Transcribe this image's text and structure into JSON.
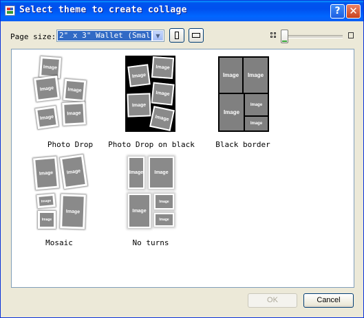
{
  "window": {
    "title": "Select theme to create collage",
    "help_label": "?",
    "close_label": "✕",
    "icons": {
      "app": "collage-app-icon",
      "help": "help-icon",
      "close": "close-icon"
    }
  },
  "toolbar": {
    "page_size_label": "Page size:",
    "page_size_value": "2\" x 3\" Wallet (Small)",
    "zoom_level": 0.0,
    "icons": {
      "portrait": "portrait-orientation-icon",
      "landscape": "landscape-orientation-icon",
      "zoom_small": "grid-thumbnails-icon",
      "zoom_large": "single-thumbnail-icon"
    }
  },
  "themes": [
    {
      "name": "Photo Drop",
      "image_labels": [
        "Image",
        "Image",
        "Image",
        "Image",
        "Image"
      ]
    },
    {
      "name": "Photo Drop on black",
      "image_labels": [
        "Image",
        "Image",
        "Image",
        "Image",
        "Image"
      ]
    },
    {
      "name": "Black border",
      "image_labels": [
        "Image",
        "Image",
        "Image",
        "Image",
        "Image"
      ]
    },
    {
      "name": "Mosaic",
      "image_labels": [
        "Image",
        "Image",
        "Image",
        "Image",
        "Image"
      ]
    },
    {
      "name": "No turns",
      "image_labels": [
        "Image",
        "Image",
        "Image",
        "Image",
        "Image"
      ]
    }
  ],
  "buttons": {
    "ok": "OK",
    "cancel": "Cancel",
    "ok_enabled": false
  },
  "colors": {
    "title_bar": "#0054e3",
    "selection": "#316ac5",
    "zoom_accent": "#34a634",
    "dialog_bg": "#ece9d8"
  }
}
